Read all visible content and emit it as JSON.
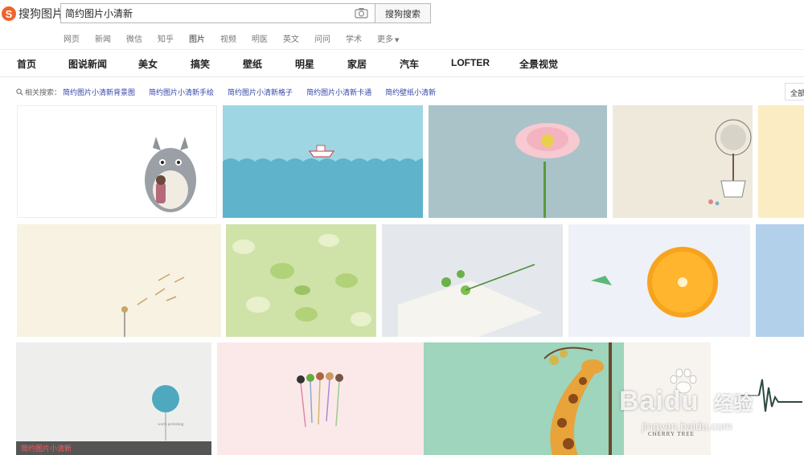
{
  "header": {
    "logo_text": "搜狗图片",
    "search_value": "简约图片小清新",
    "search_button": "搜狗搜索"
  },
  "channels": [
    "网页",
    "新闻",
    "微信",
    "知乎",
    "图片",
    "视频",
    "明医",
    "英文",
    "问问",
    "学术",
    "更多"
  ],
  "categories": [
    "首页",
    "图说新闻",
    "美女",
    "搞笑",
    "壁纸",
    "明星",
    "家居",
    "汽车",
    "LOFTER",
    "全景视觉"
  ],
  "related": {
    "label": "相关搜索：",
    "links": [
      "简约图片小清新背景图",
      "简约图片小清新手绘",
      "简约图片小清新格子",
      "简约图片小清新卡通",
      "简约壁纸小清新"
    ]
  },
  "all_button": "全部",
  "tiles": {
    "balloon_small_text": "worth persisting",
    "cherry_tree_label": "CHERRY TREE",
    "caption": "简约图片小清新"
  },
  "watermark": {
    "brand": "Baidu",
    "product": "经验",
    "url": "jingyan.baidu.com"
  },
  "colors": {
    "logo": "#f0632b",
    "link": "#3344aa",
    "caption": "#ff5a5a"
  }
}
